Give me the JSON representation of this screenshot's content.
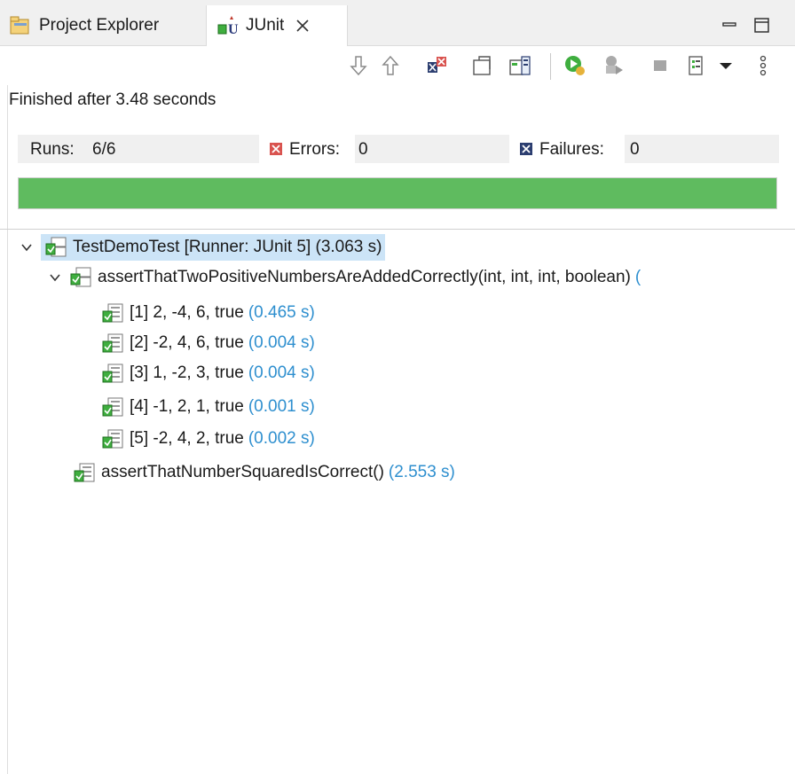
{
  "tabs": {
    "project_explorer": "Project Explorer",
    "junit": "JUnit"
  },
  "status": {
    "finished": "Finished after 3.48 seconds"
  },
  "stats": {
    "runs_label": "Runs:",
    "runs_value": "6/6",
    "errors_label": "Errors:",
    "errors_value": "0",
    "failures_label": "Failures:",
    "failures_value": "0"
  },
  "progress": {
    "fraction": 1.0,
    "color": "#5fbb5f"
  },
  "tree": {
    "root": {
      "label": "TestDemoTest [Runner: JUnit 5] (3.063 s)"
    },
    "param_suite": {
      "label": "assertThatTwoPositiveNumbersAreAddedCorrectly(int, int, int, boolean)",
      "time": "("
    },
    "cases": [
      {
        "label": "[1] 2, -4, 6, true",
        "time": "(0.465 s)"
      },
      {
        "label": "[2] -2, 4, 6, true",
        "time": "(0.004 s)"
      },
      {
        "label": "[3] 1, -2, 3, true",
        "time": "(0.004 s)"
      },
      {
        "label": "[4] -1, 2, 1, true",
        "time": "(0.001 s)"
      },
      {
        "label": "[5] -2, 4, 2, true",
        "time": "(0.002 s)"
      }
    ],
    "squared": {
      "label": "assertThatNumberSquaredIsCorrect()",
      "time": "(2.553 s)"
    }
  },
  "colors": {
    "accent_blue": "#2e8fcf",
    "pass_green": "#5fbb5f",
    "selection": "#cce4f7",
    "error_red": "#d9534f",
    "failure_navy": "#2c3e70"
  }
}
